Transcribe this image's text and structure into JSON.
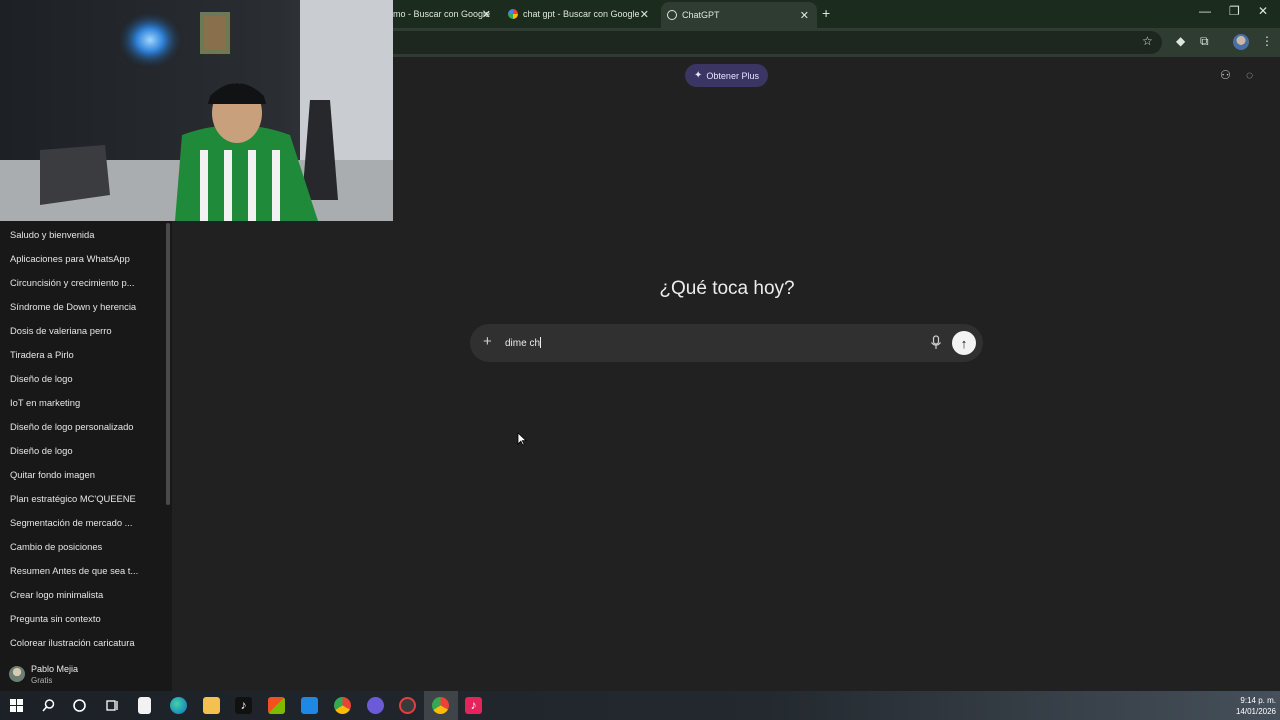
{
  "browser": {
    "tabs": [
      {
        "title": "mo - Buscar con Google"
      },
      {
        "title": "chat gpt - Buscar con Google"
      },
      {
        "title": "ChatGPT",
        "active": true
      }
    ],
    "new_tab_label": "+",
    "icons": [
      "bookmark-star-icon",
      "extension-icon",
      "puzzle-icon",
      "profile-icon",
      "menu-dots-icon"
    ]
  },
  "sidebar": {
    "chats": [
      "Saludo y bienvenida",
      "Aplicaciones para WhatsApp",
      "Circuncisión y crecimiento p...",
      "Síndrome de Down y herencia",
      "Dosis de valeriana perro",
      "Tiradera a Pirlo",
      "Diseño de logo",
      "IoT en marketing",
      "Diseño de logo personalizado",
      "Diseño de logo",
      "Quitar fondo imagen",
      "Plan estratégico MC'QUEENE",
      "Segmentación de mercado ...",
      "Cambio de posiciones",
      "Resumen Antes de que sea t...",
      "Crear logo minimalista",
      "Pregunta sin contexto",
      "Colorear ilustración caricatura"
    ],
    "user": {
      "name": "Pablo Mejia",
      "plan": "Gratis"
    }
  },
  "main": {
    "upgrade_label": "Obtener Plus",
    "headline": "¿Qué toca hoy?",
    "composer": {
      "typed_text": "dime ch",
      "plus_label": "+",
      "send_label": "↑"
    }
  },
  "taskbar": {
    "time": "9:14 p. m.",
    "date": "14/01/2026"
  },
  "colors": {
    "page_bg": "#212121",
    "sidebar_bg": "#181818",
    "composer_bg": "#303030",
    "upgrade_bg": "#3b3563",
    "browser_frame": "#2e3c31"
  }
}
